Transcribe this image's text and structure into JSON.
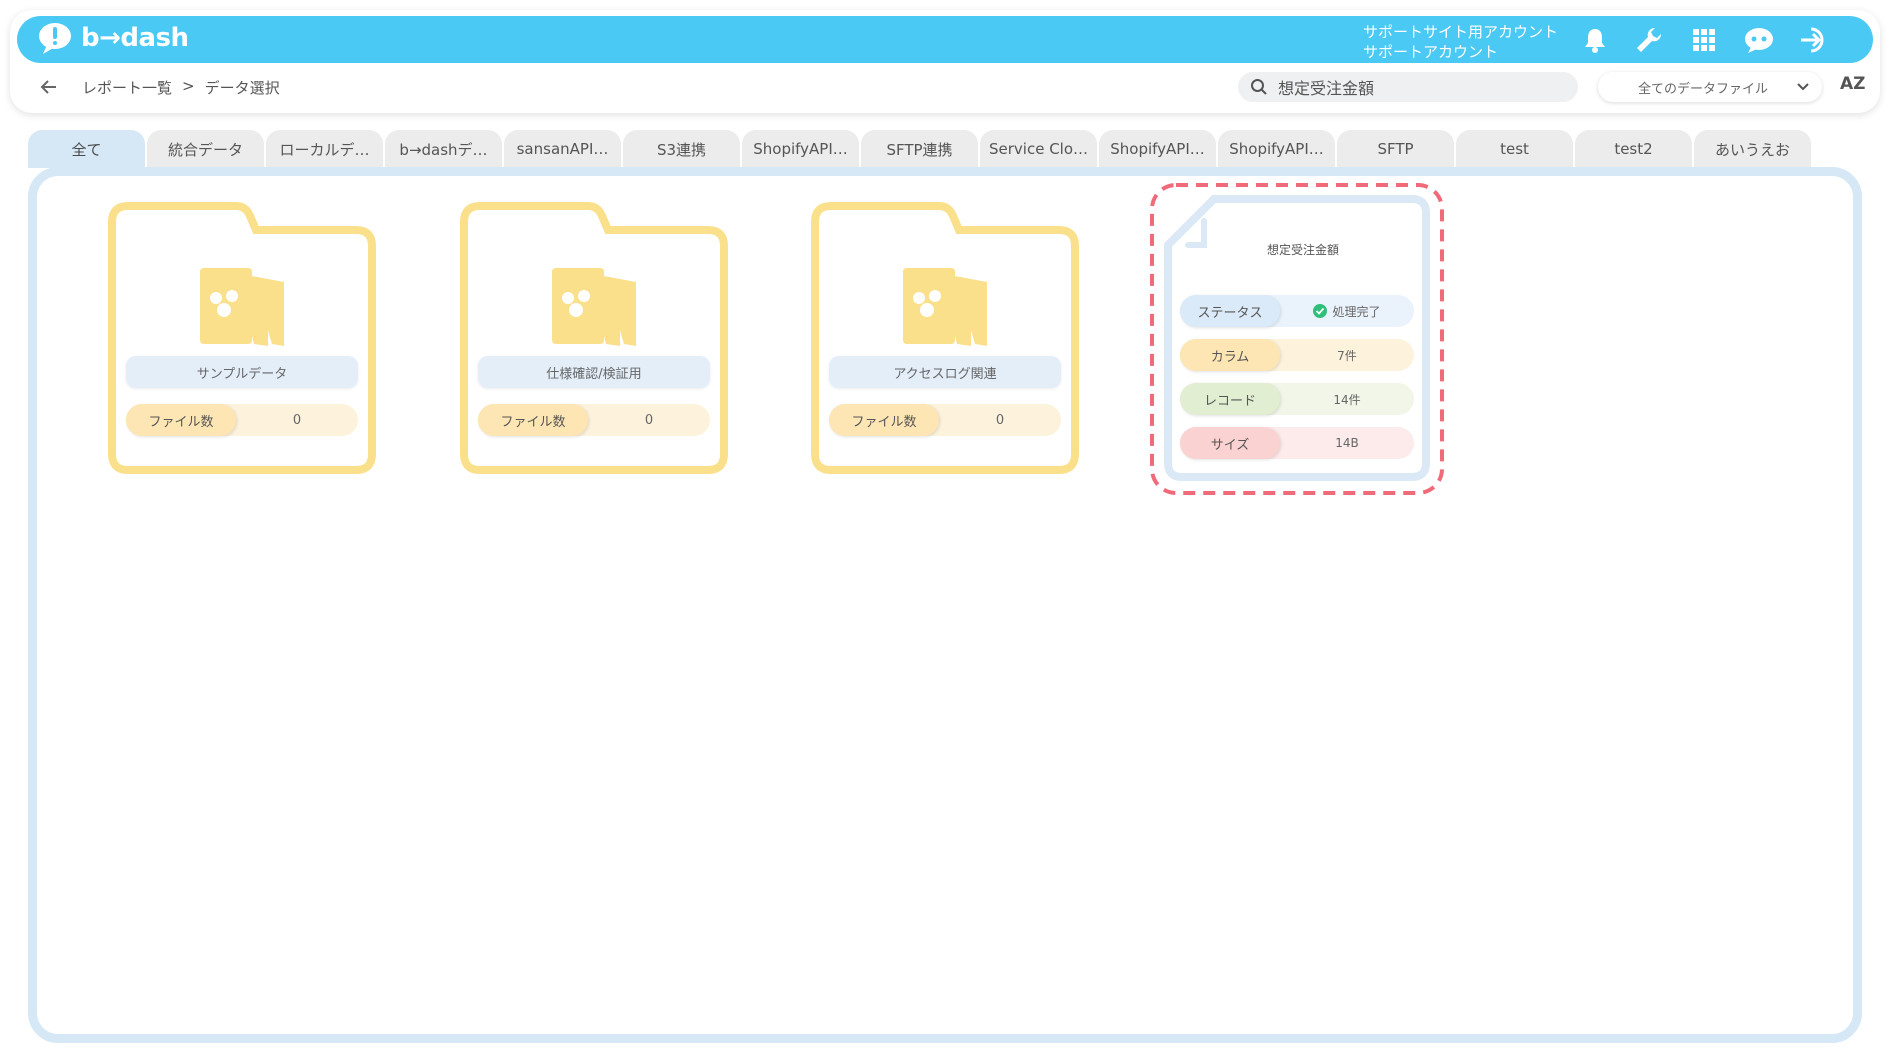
{
  "brand": {
    "logo_text": "b→dash"
  },
  "header": {
    "account_line1": "サポートサイト用アカウント",
    "account_line2": "サポートアカウント",
    "icons": [
      "bell-icon",
      "wrench-icon",
      "grid-icon",
      "chat-bot-icon",
      "logout-icon"
    ]
  },
  "breadcrumb": {
    "parent": "レポート一覧",
    "separator": ">",
    "current": "データ選択"
  },
  "search": {
    "value": "想定受注金額",
    "placeholder": ""
  },
  "filter": {
    "selected": "全てのデータファイル"
  },
  "sort": {
    "label": "AZ"
  },
  "tabs": [
    {
      "label": "全て"
    },
    {
      "label": "統合データ"
    },
    {
      "label": "ローカルデ…"
    },
    {
      "label": "b→dashデ…"
    },
    {
      "label": "sansanAPI…"
    },
    {
      "label": "S3連携"
    },
    {
      "label": "ShopifyAPI…"
    },
    {
      "label": "SFTP連携"
    },
    {
      "label": "Service Clo…"
    },
    {
      "label": "ShopifyAPI…"
    },
    {
      "label": "ShopifyAPI…"
    },
    {
      "label": "SFTP"
    },
    {
      "label": "test"
    },
    {
      "label": "test2"
    },
    {
      "label": "あいうえお"
    }
  ],
  "folders": [
    {
      "name": "サンプルデータ",
      "count_label": "ファイル数",
      "count": "0"
    },
    {
      "name": "仕様確認/検証用",
      "count_label": "ファイル数",
      "count": "0"
    },
    {
      "name": "アクセスログ関連",
      "count_label": "ファイル数",
      "count": "0"
    }
  ],
  "file": {
    "name": "想定受注金額",
    "rows": [
      {
        "label": "ステータス",
        "value": "処理完了"
      },
      {
        "label": "カラム",
        "value": "7件"
      },
      {
        "label": "レコード",
        "value": "14件"
      },
      {
        "label": "サイズ",
        "value": "14B"
      }
    ]
  },
  "colors": {
    "topbar": "#4ac9f5",
    "folder_border": "#fbe08c",
    "file_border": "#dbe9f6",
    "highlight": "#f06a7a",
    "status_ok": "#2fbf7a"
  }
}
